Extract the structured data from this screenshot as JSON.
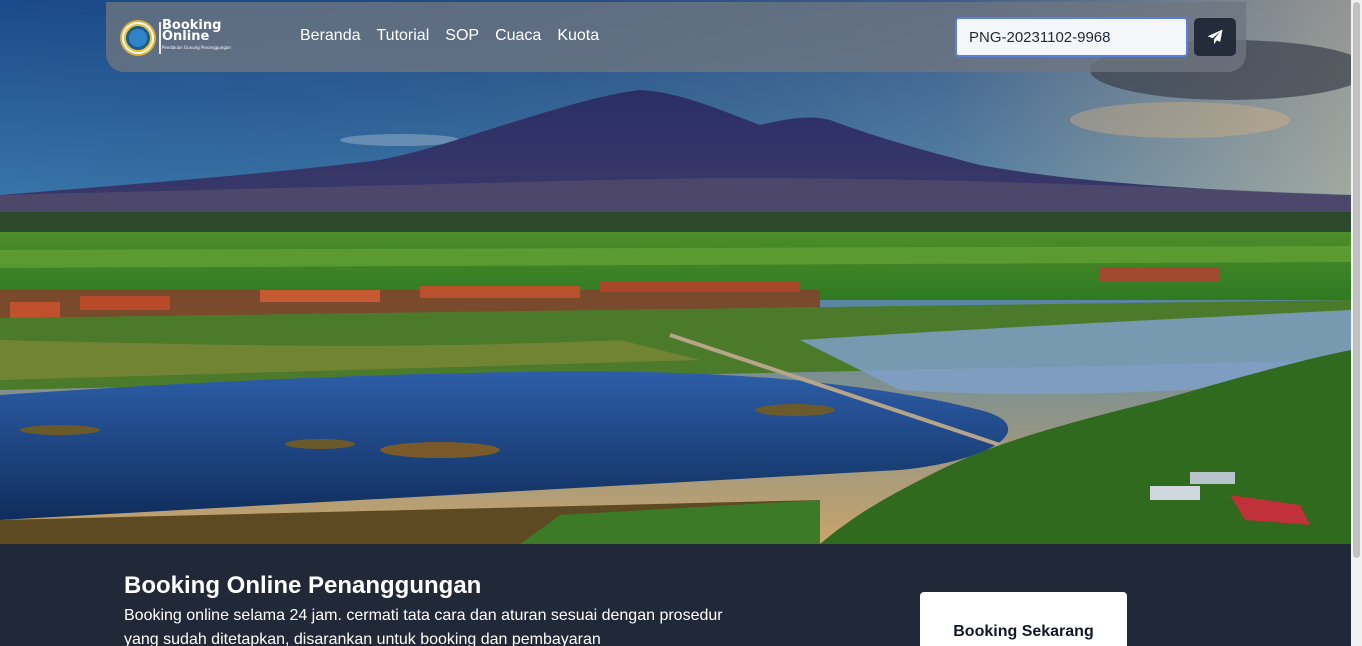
{
  "logo": {
    "line1": "Booking",
    "line2": "Online",
    "tagline": "Pendakian Gunung Penanggungan"
  },
  "nav": {
    "items": [
      "Beranda",
      "Tutorial",
      "SOP",
      "Cuaca",
      "Kuota"
    ]
  },
  "search": {
    "value": "PNG-20231102-9968"
  },
  "icons": {
    "submit": "paper-plane-icon"
  },
  "hero": {
    "title": "Booking Online Penanggungan",
    "description": "Booking online selama 24 jam. cermati tata cara dan aturan sesuai dengan prosedur yang sudah ditetapkan, disarankan untuk booking dan pembayaran",
    "cta": "Booking Sekarang"
  }
}
